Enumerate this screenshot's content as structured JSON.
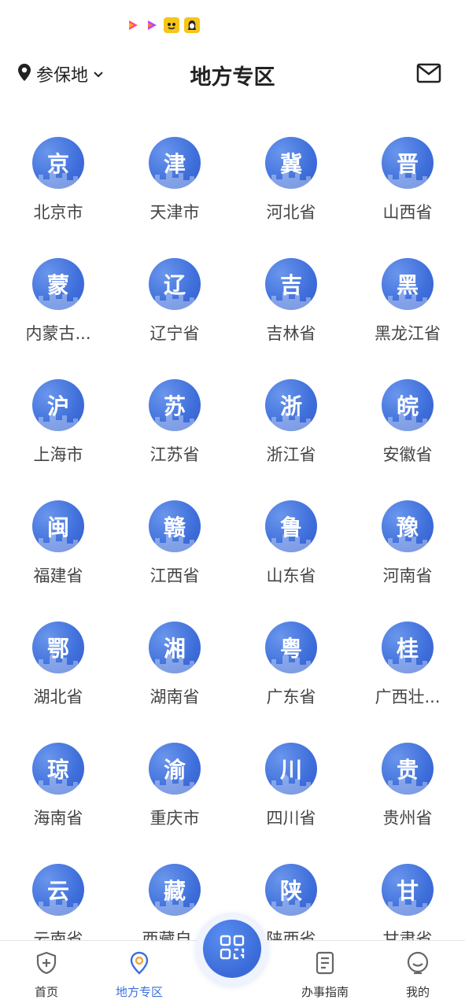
{
  "status_bar": {
    "icons": [
      "video-play-icon",
      "video-play-icon-2",
      "app-badge-icon",
      "app-badge-icon-2"
    ]
  },
  "header": {
    "location_label": "参保地",
    "title": "地方专区",
    "mail_icon": "mail-icon"
  },
  "regions": [
    {
      "glyph": "京",
      "name": "北京市"
    },
    {
      "glyph": "津",
      "name": "天津市"
    },
    {
      "glyph": "冀",
      "name": "河北省"
    },
    {
      "glyph": "晋",
      "name": "山西省"
    },
    {
      "glyph": "蒙",
      "name": "内蒙古..."
    },
    {
      "glyph": "辽",
      "name": "辽宁省"
    },
    {
      "glyph": "吉",
      "name": "吉林省"
    },
    {
      "glyph": "黑",
      "name": "黑龙江省"
    },
    {
      "glyph": "沪",
      "name": "上海市"
    },
    {
      "glyph": "苏",
      "name": "江苏省"
    },
    {
      "glyph": "浙",
      "name": "浙江省"
    },
    {
      "glyph": "皖",
      "name": "安徽省"
    },
    {
      "glyph": "闽",
      "name": "福建省"
    },
    {
      "glyph": "赣",
      "name": "江西省"
    },
    {
      "glyph": "鲁",
      "name": "山东省"
    },
    {
      "glyph": "豫",
      "name": "河南省"
    },
    {
      "glyph": "鄂",
      "name": "湖北省"
    },
    {
      "glyph": "湘",
      "name": "湖南省"
    },
    {
      "glyph": "粤",
      "name": "广东省"
    },
    {
      "glyph": "桂",
      "name": "广西壮..."
    },
    {
      "glyph": "琼",
      "name": "海南省"
    },
    {
      "glyph": "渝",
      "name": "重庆市"
    },
    {
      "glyph": "川",
      "name": "四川省"
    },
    {
      "glyph": "贵",
      "name": "贵州省"
    },
    {
      "glyph": "云",
      "name": "云南省"
    },
    {
      "glyph": "藏",
      "name": "西藏自..."
    },
    {
      "glyph": "陕",
      "name": "陕西省"
    },
    {
      "glyph": "甘",
      "name": "甘肃省"
    }
  ],
  "bottom_nav": {
    "tabs": [
      {
        "label": "首页",
        "icon": "shield-plus-icon",
        "active": false
      },
      {
        "label": "地方专区",
        "icon": "location-pin-icon",
        "active": true
      },
      {
        "label": "办事指南",
        "icon": "document-icon",
        "active": false
      },
      {
        "label": "我的",
        "icon": "smiley-icon",
        "active": false
      }
    ],
    "scan_icon": "qr-scan-icon"
  },
  "colors": {
    "accent": "#3b6fdc",
    "circle": "#3f6fdb",
    "text": "#444444"
  }
}
